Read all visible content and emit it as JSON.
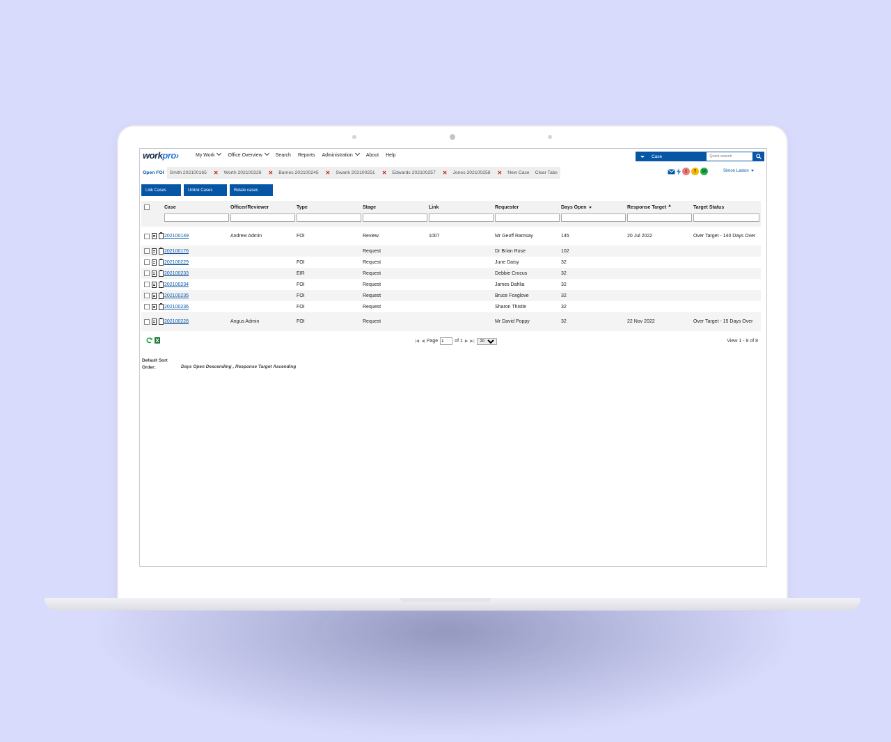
{
  "app": {
    "logo_main": "work",
    "logo_accent": "pro"
  },
  "nav": [
    {
      "label": "My Work",
      "dropdown": true
    },
    {
      "label": "Office Overview",
      "dropdown": true
    },
    {
      "label": "Search",
      "dropdown": false
    },
    {
      "label": "Reports",
      "dropdown": false
    },
    {
      "label": "Administration",
      "dropdown": true
    },
    {
      "label": "About",
      "dropdown": false
    },
    {
      "label": "Help",
      "dropdown": false
    }
  ],
  "search": {
    "type_label": "Case",
    "placeholder": "Quick search"
  },
  "tabs": [
    {
      "label": "Open FOI",
      "closable": false,
      "active": true
    },
    {
      "label": "Smith 202100165",
      "closable": true
    },
    {
      "label": "Worth 202100226",
      "closable": true
    },
    {
      "label": "Barnes 202100245",
      "closable": true
    },
    {
      "label": "Swank 202100251",
      "closable": true
    },
    {
      "label": "Edwards 202100257",
      "closable": true
    },
    {
      "label": "Jones 202100258",
      "closable": true
    },
    {
      "label": "New Case",
      "closable": false
    },
    {
      "label": "Clear Tabs",
      "closable": false
    }
  ],
  "notifications": {
    "red": "1",
    "amber": "7",
    "green": "10",
    "red_color": "#f07a7a",
    "amber_color": "#f5b800",
    "green_color": "#1fb84a"
  },
  "user": {
    "name": "Simon Laxton"
  },
  "actions": {
    "link": "Link Cases",
    "unlink": "Unlink Cases",
    "relate": "Relate cases"
  },
  "table": {
    "columns": [
      "Case",
      "Officer/Reviewer",
      "Type",
      "Stage",
      "Link",
      "Requester",
      "Days Open",
      "Response Target",
      "Target Status"
    ],
    "rows": [
      {
        "case": "202100149",
        "officer": "Andrew Admin",
        "type": "FOI",
        "stage": "Review",
        "link": "1007",
        "requester": "Mr Geoff Ramsay",
        "days": "145",
        "target": "20 Jul 2022",
        "status": "Over Target - 140 Days Over"
      },
      {
        "case": "202100176",
        "officer": "",
        "type": "",
        "stage": "Request",
        "link": "",
        "requester": "Dr Brian Rose",
        "days": "102",
        "target": "",
        "status": ""
      },
      {
        "case": "202100229",
        "officer": "",
        "type": "FOI",
        "stage": "Request",
        "link": "",
        "requester": "June Daisy",
        "days": "32",
        "target": "",
        "status": ""
      },
      {
        "case": "202100233",
        "officer": "",
        "type": "EIR",
        "stage": "Request",
        "link": "",
        "requester": "Debbie Crocus",
        "days": "32",
        "target": "",
        "status": ""
      },
      {
        "case": "202100234",
        "officer": "",
        "type": "FOI",
        "stage": "Request",
        "link": "",
        "requester": "James Dahlia",
        "days": "32",
        "target": "",
        "status": ""
      },
      {
        "case": "202100235",
        "officer": "",
        "type": "FOI",
        "stage": "Request",
        "link": "",
        "requester": "Bruce Foxglove",
        "days": "32",
        "target": "",
        "status": ""
      },
      {
        "case": "202100236",
        "officer": "",
        "type": "FOI",
        "stage": "Request",
        "link": "",
        "requester": "Sharon Thistle",
        "days": "32",
        "target": "",
        "status": ""
      },
      {
        "case": "202100228",
        "officer": "Angus Admin",
        "type": "FOI",
        "stage": "Request",
        "link": "",
        "requester": "Mr David Poppy",
        "days": "32",
        "target": "22 Nov 2022",
        "status": "Over Target - 15 Days Over"
      }
    ]
  },
  "pager": {
    "page_label": "Page",
    "page": "1",
    "of_label": "of 1",
    "page_size": "20",
    "view_text": "View 1 - 8 of 8"
  },
  "sort": {
    "label": "Default Sort Order:",
    "value": "Days Open Descending , Response Target Ascending"
  }
}
